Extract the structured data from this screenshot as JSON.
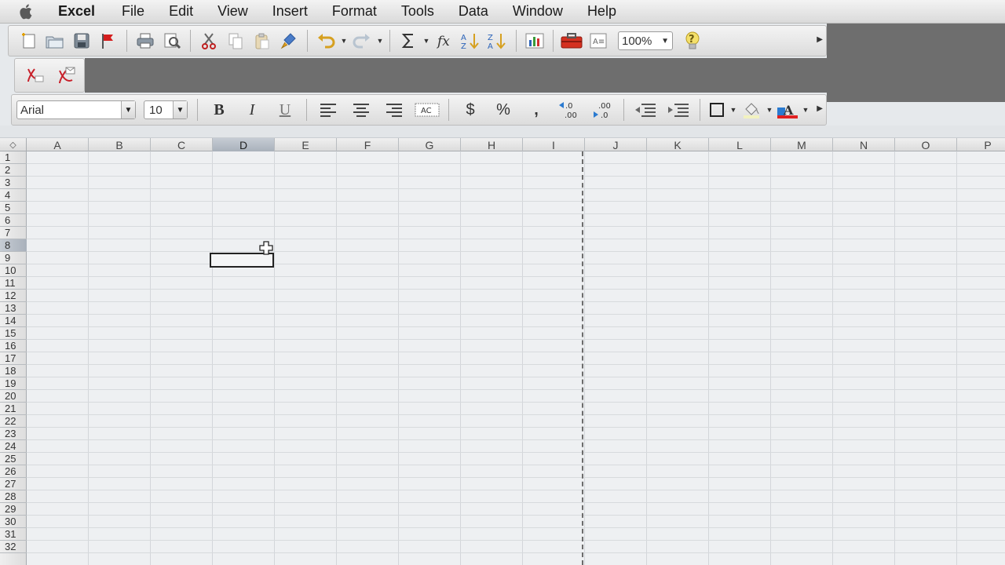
{
  "menubar": {
    "app": "Excel",
    "items": [
      "File",
      "Edit",
      "View",
      "Insert",
      "Format",
      "Tools",
      "Data",
      "Window",
      "Help"
    ]
  },
  "toolbar": {
    "zoom": "100%"
  },
  "format": {
    "font": "Arial",
    "size": "10",
    "bold": "B",
    "italic": "I",
    "underline": "U",
    "currency": "$",
    "percent": "%",
    "comma": ","
  },
  "grid": {
    "columns": [
      "A",
      "B",
      "C",
      "D",
      "E",
      "F",
      "G",
      "H",
      "I",
      "J",
      "K",
      "L",
      "M",
      "N",
      "O",
      "P"
    ],
    "rows": [
      "1",
      "2",
      "3",
      "4",
      "5",
      "6",
      "7",
      "8",
      "9",
      "10",
      "11",
      "12",
      "13",
      "14",
      "15",
      "16",
      "17",
      "18",
      "19",
      "20",
      "21",
      "22",
      "23",
      "24",
      "25",
      "26",
      "27",
      "28",
      "29",
      "30",
      "31",
      "32"
    ],
    "selected_column": "D",
    "selected_row": "8"
  },
  "colors": {
    "selection_header": "#b7bec7",
    "grid_line": "#d3d6da",
    "pdf_red": "#c8202a"
  }
}
